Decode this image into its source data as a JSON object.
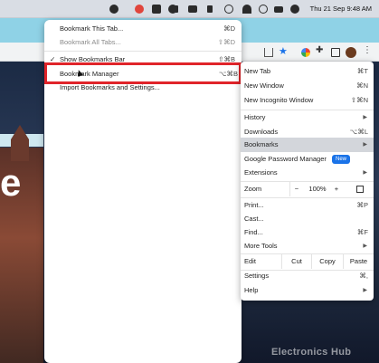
{
  "menubar": {
    "clock": "Thu 21 Sep  9:48 AM"
  },
  "bookmarks_submenu": {
    "items": [
      {
        "label": "Bookmark This Tab...",
        "shortcut": "⌘D",
        "enabled": true
      },
      {
        "label": "Bookmark All Tabs...",
        "shortcut": "⇧⌘D",
        "enabled": false
      },
      {
        "label": "Show Bookmarks Bar",
        "shortcut": "⇧⌘B",
        "checked": true,
        "check": "✓"
      },
      {
        "label": "Bookmark Manager",
        "shortcut": "⌥⌘B"
      },
      {
        "label": "Import Bookmarks and Settings..."
      }
    ]
  },
  "main_menu": {
    "new_tab": {
      "label": "New Tab",
      "shortcut": "⌘T"
    },
    "new_window": {
      "label": "New Window",
      "shortcut": "⌘N"
    },
    "new_incognito": {
      "label": "New Incognito Window",
      "shortcut": "⇧⌘N"
    },
    "history": {
      "label": "History"
    },
    "downloads": {
      "label": "Downloads",
      "shortcut": "⌥⌘L"
    },
    "bookmarks": {
      "label": "Bookmarks"
    },
    "password_manager": {
      "label": "Google Password Manager",
      "badge": "New"
    },
    "extensions": {
      "label": "Extensions"
    },
    "zoom": {
      "label": "Zoom",
      "minus": "−",
      "value": "100%",
      "plus": "+"
    },
    "print": {
      "label": "Print...",
      "shortcut": "⌘P"
    },
    "cast": {
      "label": "Cast..."
    },
    "find": {
      "label": "Find...",
      "shortcut": "⌘F"
    },
    "more_tools": {
      "label": "More Tools"
    },
    "edit": {
      "label": "Edit",
      "cut": "Cut",
      "copy": "Copy",
      "paste": "Paste"
    },
    "settings": {
      "label": "Settings",
      "shortcut": "⌘,"
    },
    "help": {
      "label": "Help"
    },
    "arrow": "▶"
  },
  "page": {
    "hero_letter": "e",
    "watermark": "Electronics Hub"
  },
  "colors": {
    "highlight_border": "#e0242a",
    "selected_row": "#d3d6db",
    "badge": "#1a73e8"
  }
}
